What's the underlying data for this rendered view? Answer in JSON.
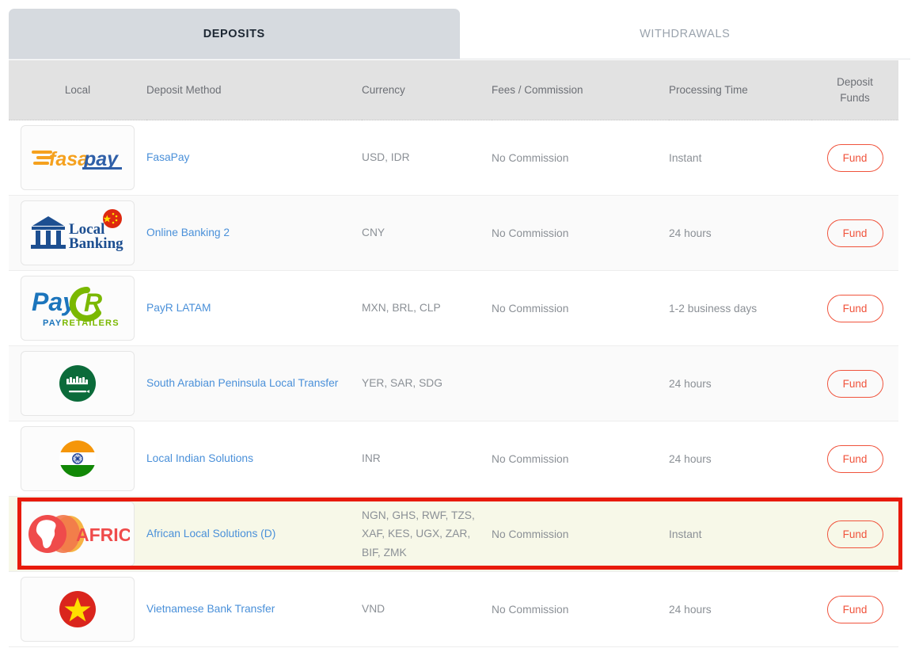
{
  "tabs": [
    {
      "label": "DEPOSITS",
      "active": true
    },
    {
      "label": "WITHDRAWALS",
      "active": false
    }
  ],
  "table": {
    "columns": {
      "local": "Local",
      "method": "Deposit Method",
      "currency": "Currency",
      "fees": "Fees / Commission",
      "processing": "Processing Time",
      "fund_line1": "Deposit",
      "fund_line2": "Funds"
    },
    "rows": [
      {
        "logo": "fasapay-logo",
        "method": "FasaPay",
        "currency": "USD, IDR",
        "fees": "No Commission",
        "processing": "Instant",
        "action": "Fund"
      },
      {
        "logo": "local-banking-cn-logo",
        "method": "Online Banking 2",
        "currency": "CNY",
        "fees": "No Commission",
        "processing": "24 hours",
        "action": "Fund"
      },
      {
        "logo": "payr-latam-logo",
        "method": "PayR LATAM",
        "currency": "MXN, BRL, CLP",
        "fees": "No Commission",
        "processing": "1-2 business days",
        "action": "Fund"
      },
      {
        "logo": "saudi-arabia-flag-logo",
        "method": "South Arabian Peninsula Local Transfer",
        "currency": "YER, SAR, SDG",
        "fees": "",
        "processing": "24 hours",
        "action": "Fund"
      },
      {
        "logo": "india-flag-logo",
        "method": "Local Indian Solutions",
        "currency": "INR",
        "fees": "No Commission",
        "processing": "24 hours",
        "action": "Fund"
      },
      {
        "logo": "africa-logo",
        "method": "African Local Solutions (D)",
        "currency": "NGN, GHS, RWF, TZS, XAF, KES, UGX, ZAR, BIF, ZMK",
        "fees": "No Commission",
        "processing": "Instant",
        "action": "Fund"
      },
      {
        "logo": "vietnam-flag-logo",
        "method": "Vietnamese Bank Transfer",
        "currency": "VND",
        "fees": "No Commission",
        "processing": "24 hours",
        "action": "Fund"
      }
    ]
  },
  "annotation": {
    "target_row_index": 5,
    "color": "#e81a0c"
  },
  "colors": {
    "accent": "#f0533c",
    "link": "#4a90d9",
    "tab_active_bg": "#d6dadf",
    "header_bg": "#e2e2e2",
    "highlight_row_bg": "#f7f8e8"
  }
}
